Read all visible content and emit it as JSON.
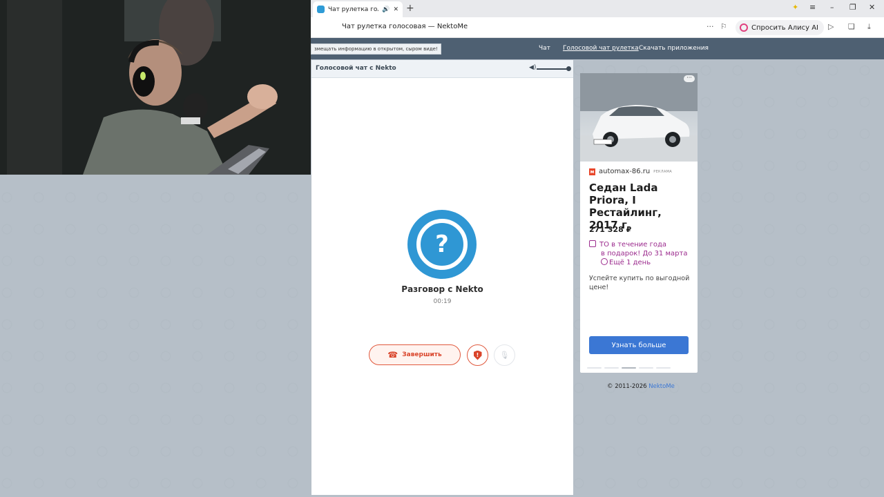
{
  "browser": {
    "tab_title": "Чат рулетка голосовая — NektoMe",
    "tab_sound_icon": "speaker-icon",
    "tab_close": "✕",
    "new_tab": "+",
    "window_controls": [
      "≡",
      "–",
      "❐",
      "✕"
    ],
    "url_text": "Чат рулетка голосовая — NektoMe",
    "more_dots": "···",
    "alice_label": "Спросить Алису AI"
  },
  "sitenav": {
    "info_badge": "змещать информацию в открытом, сыром виде!",
    "links": [
      "Чат",
      "Голосовой чат рулетка",
      "Скачать приложения"
    ]
  },
  "chat": {
    "header_title": "Голосовой чат с Nekto",
    "avatar_glyph": "?",
    "conversation_title": "Разговор с Nekto",
    "timer": "00:19",
    "end_button_label": "Завершить",
    "report_glyph": "!"
  },
  "ad": {
    "more": "···",
    "source_icon": "м",
    "source": "automax-86.ru",
    "tag": "РЕКЛАМА",
    "title": "Седан Lada Priora, I Рестайлинг, 2017 г",
    "price": "271 328 ₽",
    "promo_line1": "ТО в течение года",
    "promo_line2": "в подарок! До 31 марта",
    "promo_line3": "Ещё 1 день",
    "description": "Успейте купить по выгодной цене!",
    "cta": "Узнать больше"
  },
  "footer": {
    "copyright": "© 2011-2026",
    "link": "NektoMe"
  },
  "colors": {
    "nav_bg": "#4e6072",
    "avatar_blue": "#2f97d4",
    "end_red": "#d9442a",
    "cta_blue": "#3b77d4",
    "promo_purple": "#9b2a8d"
  }
}
